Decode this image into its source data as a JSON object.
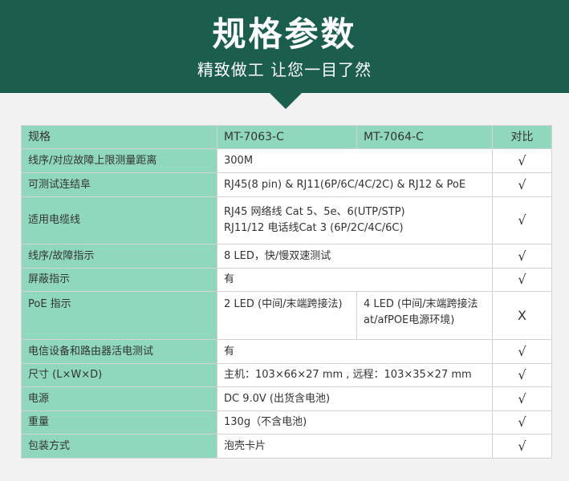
{
  "header": {
    "title": "规格参数",
    "subtitle": "精致做工 让您一目了然"
  },
  "table": {
    "head": {
      "label": "规格",
      "model_a": "MT-7063-C",
      "model_b": "MT-7064-C",
      "compare": "对比"
    },
    "rows": [
      {
        "label": "线序/对应故障上限测量距离",
        "value": "300M",
        "mark": "√"
      },
      {
        "label": "可测试连结阜",
        "value": "RJ45(8 pin) & RJ11(6P/6C/4C/2C) & RJ12 & PoE",
        "mark": "√"
      },
      {
        "label": "适用电缆线",
        "value_line1": "RJ45 网络线 Cat 5、5e、6(UTP/STP)",
        "value_line2": "RJ11/12 电话线Cat 3 (6P/2C/4C/6C)",
        "mark": "√"
      },
      {
        "label": "线序/故障指示",
        "value": "8 LED，快/慢双速测试",
        "mark": "√"
      },
      {
        "label": "屏蔽指示",
        "value": "有",
        "mark": "√"
      },
      {
        "label": "PoE 指示",
        "value_a": "2 LED (中间/末端跨接法)",
        "value_b_line1": "4 LED (中间/末端跨接法",
        "value_b_line2": "at/afPOE电源环境)",
        "mark": "X"
      },
      {
        "label": "电信设备和路由器活电测试",
        "value": "有",
        "mark": "√"
      },
      {
        "label": "尺寸 (L×W×D)",
        "value": "主机：103×66×27 mm , 远程：103×35×27 mm",
        "mark": "√"
      },
      {
        "label": "电源",
        "value": "DC 9.0V (出货含电池)",
        "mark": "√"
      },
      {
        "label": "重量",
        "value": "130g（不含电池)",
        "mark": "√"
      },
      {
        "label": "包装方式",
        "value": "泡壳卡片",
        "mark": "√"
      }
    ]
  },
  "colors": {
    "header_bg": "#1b5e4d",
    "label_bg": "#8fd8bd",
    "page_bg": "#f2f2f2"
  }
}
